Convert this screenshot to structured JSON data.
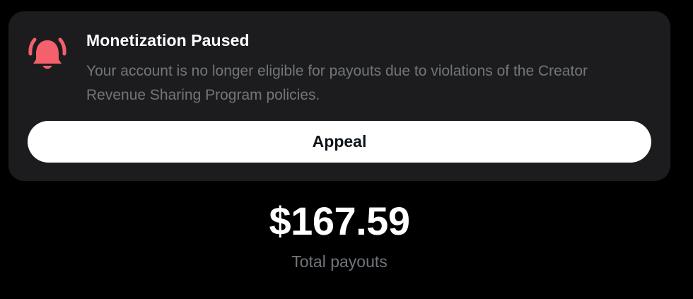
{
  "notice": {
    "icon": "bell-ringing-icon",
    "icon_color": "#f4606c",
    "title": "Monetization Paused",
    "body": "Your account is no longer eligible for payouts due to violations of the Creator Revenue Sharing Program policies.",
    "appeal_label": "Appeal"
  },
  "payouts": {
    "amount": "$167.59",
    "label": "Total payouts"
  },
  "colors": {
    "background": "#000000",
    "card": "#1c1c1e",
    "muted_text": "#71767b",
    "button_bg": "#ffffff"
  }
}
